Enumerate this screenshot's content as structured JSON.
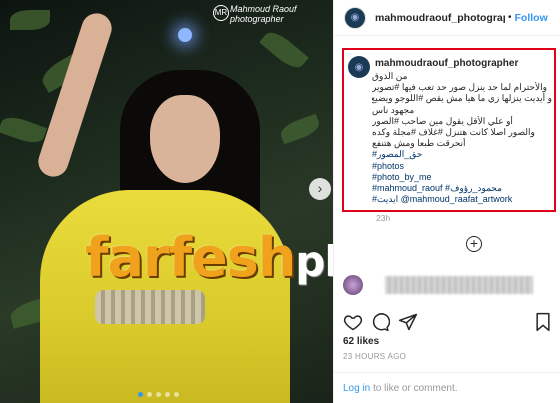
{
  "photo": {
    "watermark_text": "farfesh",
    "watermark_suffix": "plus.com",
    "stamp_line1": "Mahmoud Raouf",
    "stamp_line2": "photographer",
    "stamp_logo": "MR",
    "next_icon": "chevron-right-icon",
    "carousel_dots": 5,
    "carousel_active": 1
  },
  "header": {
    "username": "mahmoudraouf_photographer",
    "separator": "•",
    "follow_label": "Follow"
  },
  "caption": {
    "username": "mahmoudraouf_photographer",
    "lines": [
      "من الذوق",
      "والأحترام لما حد ينزل صور حد تعب فيها #تصوير",
      "و أيديت ينزلها زي ما هيا مش يقص #اللوجو ويضيع",
      "مجهود ناس",
      "أو علي الأقل يقول مين صاحب #الصور",
      "والصور اصلا كانت هتنزل #غلاف #مجلة وكده",
      "أنحرقت طبعا ومش هتنفع",
      "حق_المصور#",
      "#photos",
      "#photo_by_me",
      "#mahmoud_raouf #محمود_رؤوف",
      "#ايديت @mahmoud_raafat_artwork"
    ],
    "time_small": "23h",
    "more_comments_icon": "plus-circle-icon"
  },
  "comment": {
    "avatar_icon": "commenter-avatar"
  },
  "actions": {
    "like_icon": "heart-icon",
    "comment_icon": "comment-icon",
    "share_icon": "share-icon",
    "save_icon": "bookmark-icon"
  },
  "likes_text": "62 likes",
  "time_ago": "23 HOURS AGO",
  "login": {
    "link_label": "Log in",
    "rest": " to like or comment."
  }
}
